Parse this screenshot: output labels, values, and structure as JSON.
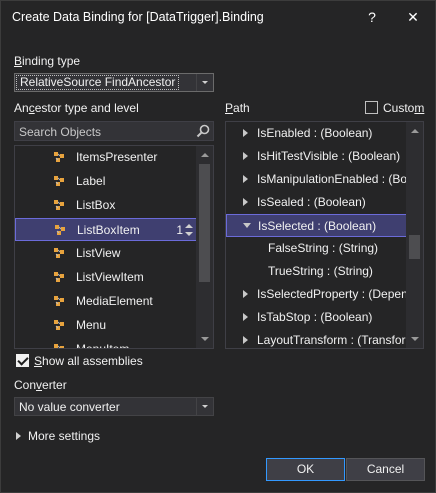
{
  "window": {
    "title": "Create Data Binding for [DataTrigger].Binding",
    "help_glyph": "?",
    "close_glyph": "✕"
  },
  "binding_type": {
    "label_pre": "",
    "label_key": "B",
    "label_post": "inding type",
    "selected": "RelativeSource FindAncestor"
  },
  "ancestor": {
    "label_pre": "An",
    "label_key": "c",
    "label_post": "estor type and level",
    "search_placeholder": "Search Objects",
    "items": [
      {
        "label": "ItemsPresenter",
        "icon": "element-icon"
      },
      {
        "label": "Label",
        "icon": "element-icon"
      },
      {
        "label": "ListBox",
        "icon": "element-icon"
      },
      {
        "label": "ListBoxItem",
        "icon": "element-icon",
        "level": "1",
        "selected": true
      },
      {
        "label": "ListView",
        "icon": "element-icon"
      },
      {
        "label": "ListViewItem",
        "icon": "element-icon"
      },
      {
        "label": "MediaElement",
        "icon": "element-icon"
      },
      {
        "label": "Menu",
        "icon": "element-icon"
      },
      {
        "label": "MenuItem",
        "icon": "element-icon"
      }
    ]
  },
  "path": {
    "label_key": "P",
    "label_post": "ath",
    "custom_label": "Custo",
    "custom_key": "m",
    "custom_checked": false,
    "items": [
      {
        "label": "IsEnabled : (Boolean)",
        "expander": "collapsed"
      },
      {
        "label": "IsHitTestVisible : (Boolean)",
        "expander": "collapsed"
      },
      {
        "label": "IsManipulationEnabled : (Boo",
        "expander": "collapsed"
      },
      {
        "label": "IsSealed : (Boolean)",
        "expander": "collapsed"
      },
      {
        "label": "IsSelected : (Boolean)",
        "expander": "expanded",
        "selected": true
      },
      {
        "label": "FalseString : (String)",
        "expander": "none",
        "child": true
      },
      {
        "label": "TrueString : (String)",
        "expander": "none",
        "child": true
      },
      {
        "label": "IsSelectedProperty : (Depend",
        "expander": "collapsed"
      },
      {
        "label": "IsTabStop : (Boolean)",
        "expander": "collapsed"
      },
      {
        "label": "LayoutTransform : (Transform",
        "expander": "collapsed"
      }
    ]
  },
  "show_all": {
    "label_key": "S",
    "label_post": "how all assemblies",
    "checked": true
  },
  "converter": {
    "label_pre": "Con",
    "label_key": "v",
    "label_post": "erter",
    "selected": "No value converter"
  },
  "more_settings": {
    "label": "More settings"
  },
  "buttons": {
    "ok": "OK",
    "cancel": "Cancel"
  },
  "colors": {
    "background": "#252526",
    "selection": "#3f3f70",
    "selection_border": "#6b6bd9",
    "icon_orange": "#e8a33d",
    "ok_border": "#3399ff"
  }
}
